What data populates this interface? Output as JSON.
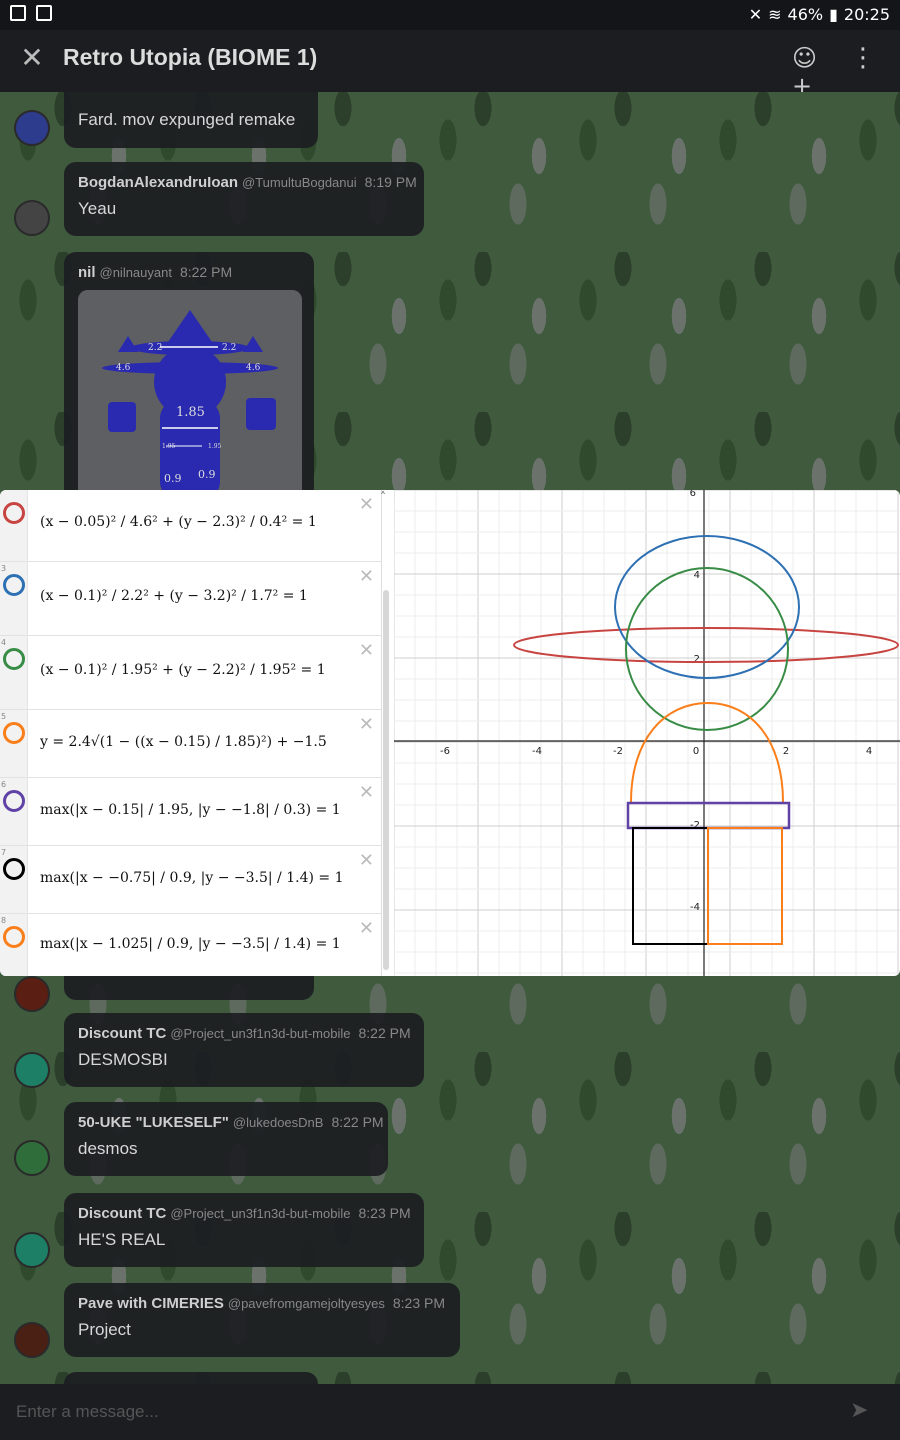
{
  "status": {
    "battery": "46%",
    "time": "20:25"
  },
  "header": {
    "title": "Retro Utopia (BIOME 1)"
  },
  "messages": [
    {
      "author": "",
      "handle": "",
      "time": "",
      "text": "Fard. mov expunged remake"
    },
    {
      "author": "BogdanAlexandruIoan",
      "handle": "@TumultuBogdanui",
      "time": "8:19 PM",
      "text": "Yeau"
    },
    {
      "author": "nil",
      "handle": "@nilnauyant",
      "time": "8:22 PM",
      "text": ""
    },
    {
      "author": "Discount TC",
      "handle": "@Project_un3f1n3d-but-mobile",
      "time": "8:22 PM",
      "text": "DESMOSBI"
    },
    {
      "author": "50-UKE \"LUKESELF\"",
      "handle": "@lukedoesDnB",
      "time": "8:22 PM",
      "text": "desmos"
    },
    {
      "author": "Discount TC",
      "handle": "@Project_un3f1n3d-but-mobile",
      "time": "8:23 PM",
      "text": "HE'S REAL"
    },
    {
      "author": "Pave with CIMERIES",
      "handle": "@pavefromgamejoltyesyes",
      "time": "8:23 PM",
      "text": "Project"
    }
  ],
  "attachment": {
    "labels": [
      "2.2",
      "2.2",
      "4.6",
      "4.6",
      "1.85",
      "1.95",
      "1.95",
      "0.9",
      "0.9"
    ]
  },
  "desmos": {
    "expressions": [
      {
        "num": "",
        "color": "#c74440",
        "formula": "(x − 0.05)² / 4.6² + (y − 2.3)² / 0.4² = 1"
      },
      {
        "num": "3",
        "color": "#2d70b3",
        "formula": "(x − 0.1)² / 2.2² + (y − 3.2)² / 1.7² = 1"
      },
      {
        "num": "4",
        "color": "#388c46",
        "formula": "(x − 0.1)² / 1.95² + (y − 2.2)² / 1.95² = 1"
      },
      {
        "num": "5",
        "color": "#fa7e19",
        "formula": "y = 2.4√(1 − ((x − 0.15) / 1.85)²) + −1.5"
      },
      {
        "num": "6",
        "color": "#6042a6",
        "formula": "max(|x − 0.15| / 1.95, |y − −1.8| / 0.3) = 1"
      },
      {
        "num": "7",
        "color": "#000000",
        "formula": "max(|x − −0.75| / 0.9, |y − −3.5| / 1.4) = 1"
      },
      {
        "num": "8",
        "color": "#fa7e19",
        "formula": "max(|x − 1.025| / 0.9, |y − −3.5| / 1.4) = 1"
      }
    ],
    "axis_labels": {
      "x": [
        "-6",
        "-4",
        "-2",
        "0",
        "2",
        "4"
      ],
      "y": [
        "6",
        "4",
        "2",
        "-2",
        "-4"
      ]
    }
  },
  "composer": {
    "placeholder": "Enter a message..."
  }
}
